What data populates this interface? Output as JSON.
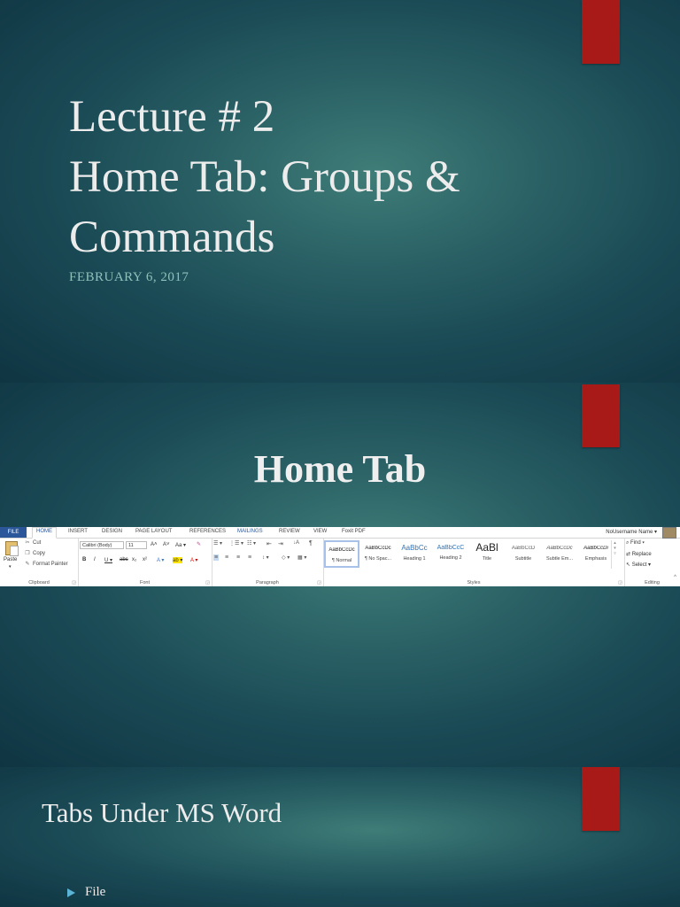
{
  "slide1": {
    "title_lines": [
      "Lecture # 2",
      "Home Tab: Groups &",
      "Commands"
    ],
    "date": "FEBRUARY 6, 2017"
  },
  "slide2": {
    "title": "Home Tab",
    "ribbon": {
      "tabs": [
        "FILE",
        "HOME",
        "INSERT",
        "DESIGN",
        "PAGE LAYOUT",
        "REFERENCES",
        "MAILINGS",
        "REVIEW",
        "VIEW",
        "Foxit PDF"
      ],
      "user": "NoUsername Name ▾",
      "clipboard": {
        "paste": "Paste",
        "cut": "Cut",
        "copy": "Copy",
        "format_painter": "Format Painter",
        "label": "Clipboard"
      },
      "font": {
        "font_name": "Calibri (Body)",
        "font_size": "11",
        "grow": "A˄",
        "shrink": "A˅",
        "case": "Aa ▾",
        "clear": "✎",
        "bold": "B",
        "italic": "I",
        "underline": "U ▾",
        "strike": "abc",
        "subscript": "x₂",
        "superscript": "x²",
        "text_effects": "A ▾",
        "highlight": "ab ▾",
        "font_color": "A ▾",
        "label": "Font"
      },
      "paragraph": {
        "bullets": "☰ ▾",
        "numbering": "⋮☰ ▾",
        "multilevel": "☷ ▾",
        "decrease_indent": "⇤",
        "increase_indent": "⇥",
        "sort": "↓A",
        "show_marks": "¶",
        "align_left": "≡",
        "center": "≡",
        "align_right": "≡",
        "justify": "≡",
        "line_spacing": "↕ ▾",
        "shading": "◇ ▾",
        "borders": "▦ ▾",
        "label": "Paragraph"
      },
      "styles": {
        "items": [
          {
            "preview": "AaBbCcDc",
            "name": "¶ Normal"
          },
          {
            "preview": "AaBbCcDc",
            "name": "¶ No Spac..."
          },
          {
            "preview": "AaBbCc",
            "name": "Heading 1"
          },
          {
            "preview": "AaBbCcC",
            "name": "Heading 2"
          },
          {
            "preview": "AaBl",
            "name": "Title"
          },
          {
            "preview": "AaBbCcD",
            "name": "Subtitle"
          },
          {
            "preview": "AaBbCcDc",
            "name": "Subtle Em..."
          },
          {
            "preview": "AaBbCcDi",
            "name": "Emphasis"
          }
        ],
        "label": "Styles"
      },
      "editing": {
        "find": "Find ▾",
        "replace": "Replace",
        "select": "Select ▾",
        "label": "Editing"
      },
      "colors": {
        "file_tab": "#2b579a",
        "accent_text": "#2b579a"
      }
    }
  },
  "slide3": {
    "title": "Tabs Under MS Word",
    "bullets": [
      "File"
    ]
  },
  "colors": {
    "accent_block": "#a81a18",
    "date_text": "#8fc1bb",
    "bullet_marker": "#5bb3d6"
  }
}
